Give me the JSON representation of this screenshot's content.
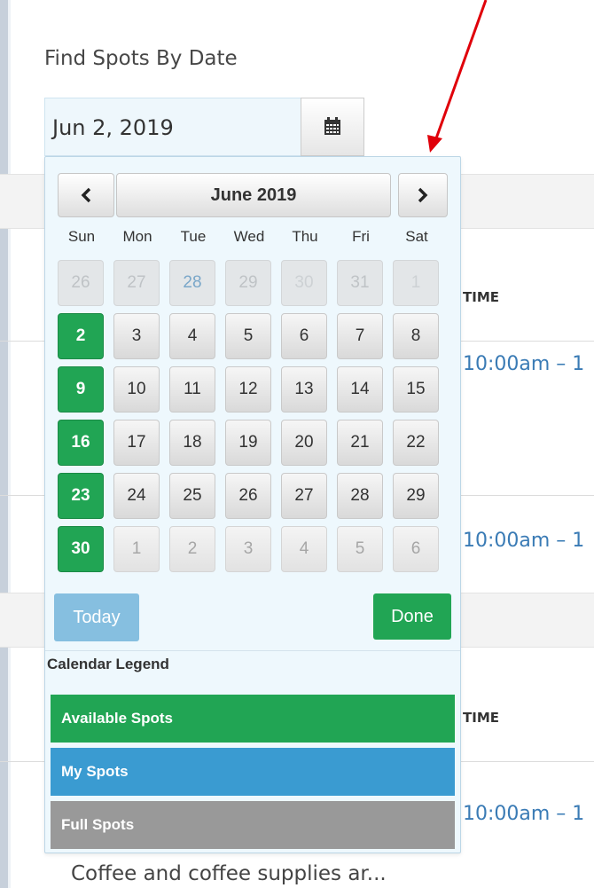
{
  "page": {
    "section_title": "Find Spots By Date",
    "date_value": "Jun 2, 2019",
    "calendar_button_icon": "calendar-icon"
  },
  "background": {
    "time_header_1": "TIME",
    "time_header_2": "TIME",
    "times": [
      "10:00am – 1",
      "10:00am – 1",
      "10:00am – 1"
    ],
    "description": "Coffee and coffee supplies ar..."
  },
  "calendar": {
    "month_label": "June 2019",
    "prev_icon": "chevron-left-icon",
    "next_icon": "chevron-right-icon",
    "weekdays": [
      "Sun",
      "Mon",
      "Tue",
      "Wed",
      "Thu",
      "Fri",
      "Sat"
    ],
    "weeks": [
      [
        "26",
        "27",
        "28",
        "29",
        "30",
        "31",
        "1"
      ],
      [
        "2",
        "3",
        "4",
        "5",
        "6",
        "7",
        "8"
      ],
      [
        "9",
        "10",
        "11",
        "12",
        "13",
        "14",
        "15"
      ],
      [
        "16",
        "17",
        "18",
        "19",
        "20",
        "21",
        "22"
      ],
      [
        "23",
        "24",
        "25",
        "26",
        "27",
        "28",
        "29"
      ],
      [
        "30",
        "1",
        "2",
        "3",
        "4",
        "5",
        "6"
      ]
    ],
    "today_label": "Today",
    "done_label": "Done"
  },
  "legend": {
    "title": "Calendar Legend",
    "items": [
      {
        "label": "Available Spots",
        "color": "#21a554"
      },
      {
        "label": "My Spots",
        "color": "#3a9bd1"
      },
      {
        "label": "Full Spots",
        "color": "#999999"
      }
    ]
  },
  "colors": {
    "available": "#21a554",
    "annotation_arrow": "#e0000a"
  }
}
